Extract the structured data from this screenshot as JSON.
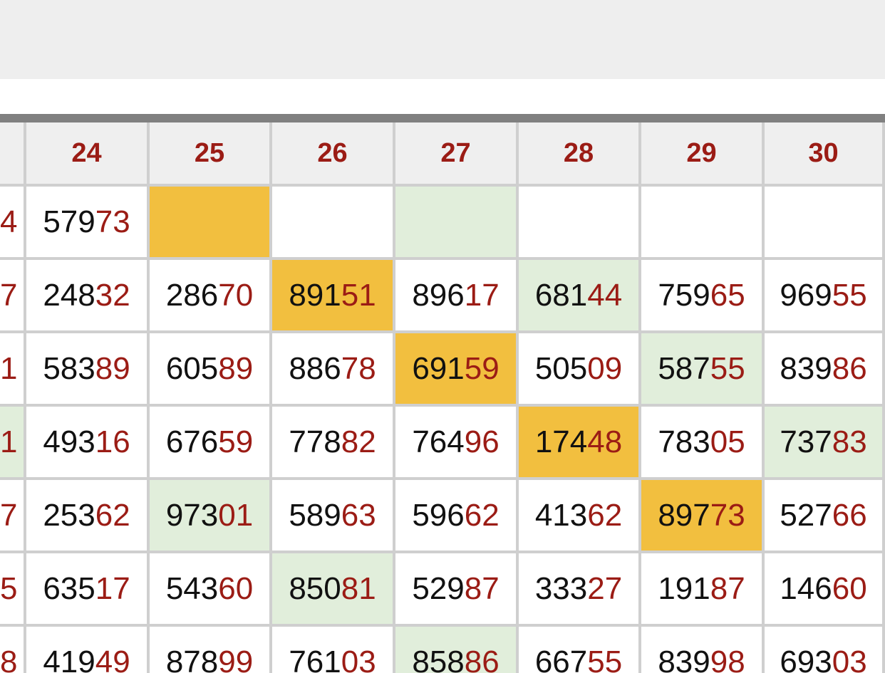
{
  "colors": {
    "accent_red": "#9b1c15",
    "highlight_gold": "#f2bf3f",
    "highlight_green": "#e1eedb",
    "header_bg": "#efefef",
    "grid_line": "#cfcfcf",
    "top_rule": "#808080"
  },
  "table": {
    "columns": [
      "",
      "24",
      "25",
      "26",
      "27",
      "28",
      "29",
      "30"
    ],
    "rows": [
      {
        "cells": [
          {
            "text": "4",
            "hl": "",
            "prefix": "",
            "suffix": "4"
          },
          {
            "text": "57973",
            "hl": "",
            "prefix": "579",
            "suffix": "73"
          },
          {
            "text": "",
            "hl": "gold",
            "prefix": "",
            "suffix": ""
          },
          {
            "text": "",
            "hl": "",
            "prefix": "",
            "suffix": ""
          },
          {
            "text": "",
            "hl": "green",
            "prefix": "",
            "suffix": ""
          },
          {
            "text": "",
            "hl": "",
            "prefix": "",
            "suffix": ""
          },
          {
            "text": "",
            "hl": "",
            "prefix": "",
            "suffix": ""
          },
          {
            "text": "",
            "hl": "",
            "prefix": "",
            "suffix": ""
          }
        ]
      },
      {
        "cells": [
          {
            "text": "7",
            "hl": "",
            "prefix": "",
            "suffix": "7"
          },
          {
            "text": "24832",
            "hl": "",
            "prefix": "248",
            "suffix": "32"
          },
          {
            "text": "28670",
            "hl": "",
            "prefix": "286",
            "suffix": "70"
          },
          {
            "text": "89151",
            "hl": "gold",
            "prefix": "891",
            "suffix": "51"
          },
          {
            "text": "89617",
            "hl": "",
            "prefix": "896",
            "suffix": "17"
          },
          {
            "text": "68144",
            "hl": "green",
            "prefix": "681",
            "suffix": "44"
          },
          {
            "text": "75965",
            "hl": "",
            "prefix": "759",
            "suffix": "65"
          },
          {
            "text": "96955",
            "hl": "",
            "prefix": "969",
            "suffix": "55"
          }
        ]
      },
      {
        "cells": [
          {
            "text": "1",
            "hl": "",
            "prefix": "",
            "suffix": "1"
          },
          {
            "text": "58389",
            "hl": "",
            "prefix": "583",
            "suffix": "89"
          },
          {
            "text": "60589",
            "hl": "",
            "prefix": "605",
            "suffix": "89"
          },
          {
            "text": "88678",
            "hl": "",
            "prefix": "886",
            "suffix": "78"
          },
          {
            "text": "69159",
            "hl": "gold",
            "prefix": "691",
            "suffix": "59"
          },
          {
            "text": "50509",
            "hl": "",
            "prefix": "505",
            "suffix": "09"
          },
          {
            "text": "58755",
            "hl": "green",
            "prefix": "587",
            "suffix": "55"
          },
          {
            "text": "83986",
            "hl": "",
            "prefix": "839",
            "suffix": "86"
          }
        ]
      },
      {
        "cells": [
          {
            "text": "1",
            "hl": "green",
            "prefix": "",
            "suffix": "1"
          },
          {
            "text": "49316",
            "hl": "",
            "prefix": "493",
            "suffix": "16"
          },
          {
            "text": "67659",
            "hl": "",
            "prefix": "676",
            "suffix": "59"
          },
          {
            "text": "77882",
            "hl": "",
            "prefix": "778",
            "suffix": "82"
          },
          {
            "text": "76496",
            "hl": "",
            "prefix": "764",
            "suffix": "96"
          },
          {
            "text": "17448",
            "hl": "gold",
            "prefix": "174",
            "suffix": "48"
          },
          {
            "text": "78305",
            "hl": "",
            "prefix": "783",
            "suffix": "05"
          },
          {
            "text": "73783",
            "hl": "green",
            "prefix": "737",
            "suffix": "83"
          }
        ]
      },
      {
        "cells": [
          {
            "text": "7",
            "hl": "",
            "prefix": "",
            "suffix": "7"
          },
          {
            "text": "25362",
            "hl": "",
            "prefix": "253",
            "suffix": "62"
          },
          {
            "text": "97301",
            "hl": "green",
            "prefix": "973",
            "suffix": "01"
          },
          {
            "text": "58963",
            "hl": "",
            "prefix": "589",
            "suffix": "63"
          },
          {
            "text": "59662",
            "hl": "",
            "prefix": "596",
            "suffix": "62"
          },
          {
            "text": "41362",
            "hl": "",
            "prefix": "413",
            "suffix": "62"
          },
          {
            "text": "89773",
            "hl": "gold",
            "prefix": "897",
            "suffix": "73"
          },
          {
            "text": "52766",
            "hl": "",
            "prefix": "527",
            "suffix": "66"
          }
        ]
      },
      {
        "cells": [
          {
            "text": "5",
            "hl": "",
            "prefix": "",
            "suffix": "5"
          },
          {
            "text": "63517",
            "hl": "",
            "prefix": "635",
            "suffix": "17"
          },
          {
            "text": "54360",
            "hl": "",
            "prefix": "543",
            "suffix": "60"
          },
          {
            "text": "85081",
            "hl": "green",
            "prefix": "850",
            "suffix": "81"
          },
          {
            "text": "52987",
            "hl": "",
            "prefix": "529",
            "suffix": "87"
          },
          {
            "text": "33327",
            "hl": "",
            "prefix": "333",
            "suffix": "27"
          },
          {
            "text": "19187",
            "hl": "",
            "prefix": "191",
            "suffix": "87"
          },
          {
            "text": "14660",
            "hl": "",
            "prefix": "146",
            "suffix": "60"
          }
        ]
      },
      {
        "cells": [
          {
            "text": "8",
            "hl": "",
            "prefix": "",
            "suffix": "8"
          },
          {
            "text": "41949",
            "hl": "",
            "prefix": "419",
            "suffix": "49"
          },
          {
            "text": "87899",
            "hl": "",
            "prefix": "878",
            "suffix": "99"
          },
          {
            "text": "76103",
            "hl": "",
            "prefix": "761",
            "suffix": "03"
          },
          {
            "text": "85886",
            "hl": "green",
            "prefix": "858",
            "suffix": "86"
          },
          {
            "text": "66755",
            "hl": "",
            "prefix": "667",
            "suffix": "55"
          },
          {
            "text": "83998",
            "hl": "",
            "prefix": "839",
            "suffix": "98"
          },
          {
            "text": "69303",
            "hl": "",
            "prefix": "693",
            "suffix": "03"
          }
        ]
      }
    ]
  }
}
